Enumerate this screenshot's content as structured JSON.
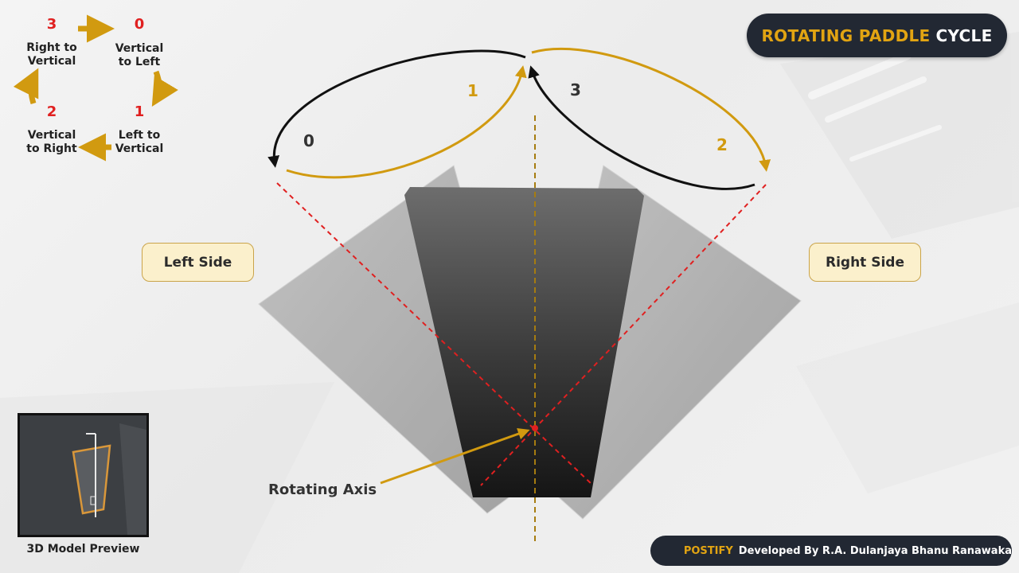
{
  "title": {
    "accent": "ROTATING PADDLE",
    "rest": "CYCLE"
  },
  "cycle_legend": [
    {
      "number": "0",
      "label_line1": "Vertical",
      "label_line2": "to Left"
    },
    {
      "number": "1",
      "label_line1": "Left to",
      "label_line2": "Vertical"
    },
    {
      "number": "2",
      "label_line1": "Vertical",
      "label_line2": "to Right"
    },
    {
      "number": "3",
      "label_line1": "Right to",
      "label_line2": "Vertical"
    }
  ],
  "arc_labels": [
    {
      "number": "0",
      "color": "#333333"
    },
    {
      "number": "1",
      "color": "#d19a10"
    },
    {
      "number": "2",
      "color": "#d19a10"
    },
    {
      "number": "3",
      "color": "#333333"
    }
  ],
  "side_labels": {
    "left": "Left Side",
    "right": "Right Side"
  },
  "axis_label": "Rotating Axis",
  "preview_caption": "3D Model Preview",
  "footer": {
    "brand": "POSTIFY",
    "credit": "Developed By R.A. Dulanjaya Bhanu Ranawaka"
  },
  "colors": {
    "accent": "#e2a412",
    "red_guides": "#e02020",
    "dark_pill": "#222833",
    "gold_arrow": "#d19a10",
    "black_arrow": "#111111"
  },
  "icons": [
    "cycle-arrow-icon",
    "envelope-logo-icon"
  ]
}
